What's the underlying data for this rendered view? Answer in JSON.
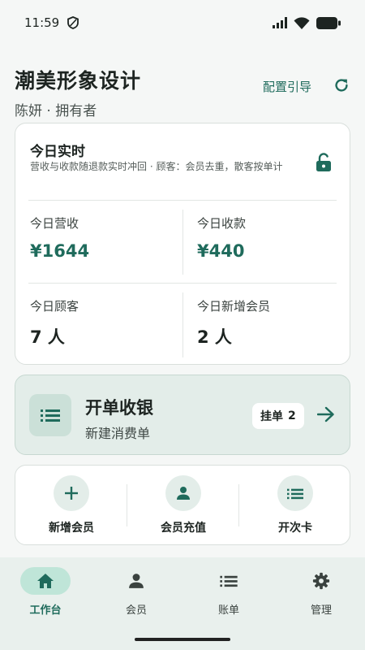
{
  "status": {
    "time": "11:59"
  },
  "header": {
    "shop_name": "潮美形象设计",
    "subtitle": "陈妍 · 拥有者",
    "config_guide": "配置引导"
  },
  "today": {
    "title": "今日实时",
    "description": "营收与收款随退款实时冲回 · 顾客：会员去重，散客按单计",
    "stats": [
      {
        "label": "今日营收",
        "value": "¥1644"
      },
      {
        "label": "今日收款",
        "value": "¥440"
      },
      {
        "label": "今日顾客",
        "value": "7 人"
      },
      {
        "label": "今日新增会员",
        "value": "2 人"
      }
    ]
  },
  "checkout": {
    "title": "开单收银",
    "subtitle": "新建消费单",
    "hold_label": "挂单",
    "hold_count": "2"
  },
  "quick_actions": [
    {
      "label": "新增会员",
      "icon": "add-icon"
    },
    {
      "label": "会员充值",
      "icon": "person-icon"
    },
    {
      "label": "开次卡",
      "icon": "list-icon"
    }
  ],
  "nav": [
    {
      "label": "工作台",
      "icon": "home-icon",
      "active": true
    },
    {
      "label": "会员",
      "icon": "person-icon",
      "active": false
    },
    {
      "label": "账单",
      "icon": "list-icon",
      "active": false
    },
    {
      "label": "管理",
      "icon": "gear-icon",
      "active": false
    }
  ],
  "colors": {
    "accent": "#1f6b5c",
    "accent_soft": "#e3ede9",
    "nav_active_pill": "#bfe5d8"
  }
}
